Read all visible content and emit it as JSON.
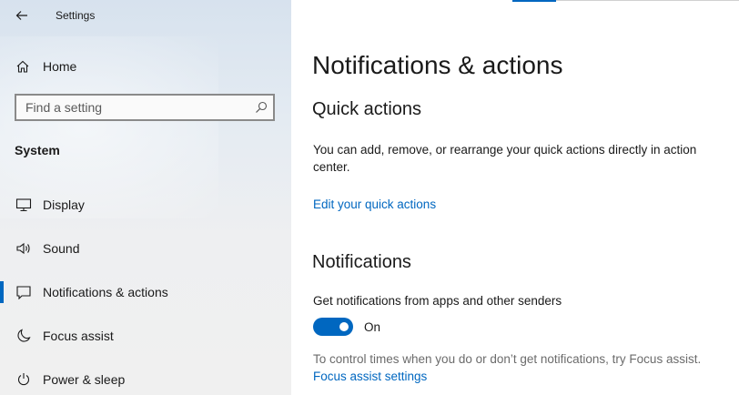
{
  "app": {
    "title": "Settings"
  },
  "sidebar": {
    "home_label": "Home",
    "search_placeholder": "Find a setting",
    "section_label": "System",
    "items": [
      {
        "label": "Display",
        "icon": "monitor-icon"
      },
      {
        "label": "Sound",
        "icon": "speaker-icon"
      },
      {
        "label": "Notifications & actions",
        "icon": "message-icon",
        "selected": true
      },
      {
        "label": "Focus assist",
        "icon": "moon-icon"
      },
      {
        "label": "Power & sleep",
        "icon": "power-icon"
      }
    ]
  },
  "main": {
    "title": "Notifications & actions",
    "quick_actions": {
      "heading": "Quick actions",
      "description": "You can add, remove, or rearrange your quick actions directly in action center.",
      "link": "Edit your quick actions"
    },
    "notifications": {
      "heading": "Notifications",
      "toggle_label": "Get notifications from apps and other senders",
      "toggle_state": "On",
      "toggle_on": true,
      "hint": "To control times when you do or don’t get notifications, try Focus assist.",
      "link": "Focus assist settings"
    }
  },
  "colors": {
    "accent": "#0067c0",
    "text": "#1a1a1a",
    "muted": "#6b6b6b"
  }
}
